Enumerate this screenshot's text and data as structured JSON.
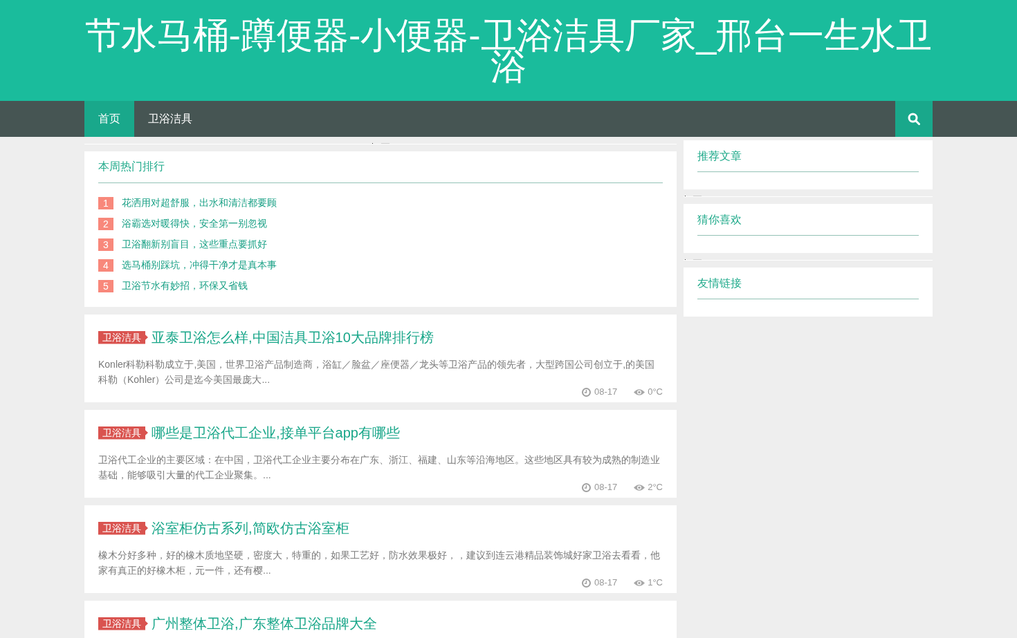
{
  "site_title": "节水马桶-蹲便器-小便器-卫浴洁具厂家_邢台一生水卫浴",
  "nav": {
    "items": [
      {
        "label": "首页",
        "selected": true
      },
      {
        "label": "卫浴洁具",
        "selected": false
      }
    ]
  },
  "hot_ranking": {
    "title": "本周热门排行",
    "items": [
      {
        "rank": "1",
        "title": "花洒用对超舒服，出水和清洁都要顾"
      },
      {
        "rank": "2",
        "title": "浴霸选对暖得快，安全第一别忽视"
      },
      {
        "rank": "3",
        "title": "卫浴翻新别盲目，这些重点要抓好"
      },
      {
        "rank": "4",
        "title": "选马桶别踩坑，冲得干净才是真本事"
      },
      {
        "rank": "5",
        "title": "卫浴节水有妙招，环保又省钱"
      }
    ]
  },
  "articles": [
    {
      "category": "卫浴洁具",
      "title": "亚泰卫浴怎么样,中国洁具卫浴10大品牌排行榜",
      "excerpt": "Konler科勒科勒成立于,美国，世界卫浴产品制造商，浴缸／脸盆／座便器／龙头等卫浴产品的领先者，大型跨国公司创立于,的美国科勒（Kohler）公司是迄今美国最庞大...",
      "date": "08-17",
      "views": "0°C"
    },
    {
      "category": "卫浴洁具",
      "title": "哪些是卫浴代工企业,接单平台app有哪些",
      "excerpt": "卫浴代工企业的主要区域：在中国，卫浴代工企业主要分布在广东、浙江、福建、山东等沿海地区。这些地区具有较为成熟的制造业基础，能够吸引大量的代工企业聚集。...",
      "date": "08-17",
      "views": "2°C"
    },
    {
      "category": "卫浴洁具",
      "title": "浴室柜仿古系列,简欧仿古浴室柜",
      "excerpt": "橡木分好多种，好的橡木质地坚硬，密度大，特重的，如果工艺好，防水效果极好，，建议到连云港精品装饰城好家卫浴去看看，他家有真正的好橡木柜，元一件，还有樱...",
      "date": "08-17",
      "views": "1°C"
    },
    {
      "category": "卫浴洁具",
      "title": "广州整体卫浴,广东整体卫浴品牌大全"
    }
  ],
  "sidebar": {
    "widgets": [
      {
        "title": "推荐文章"
      },
      {
        "title": "猜你喜欢"
      },
      {
        "title": "友情链接"
      }
    ]
  }
}
